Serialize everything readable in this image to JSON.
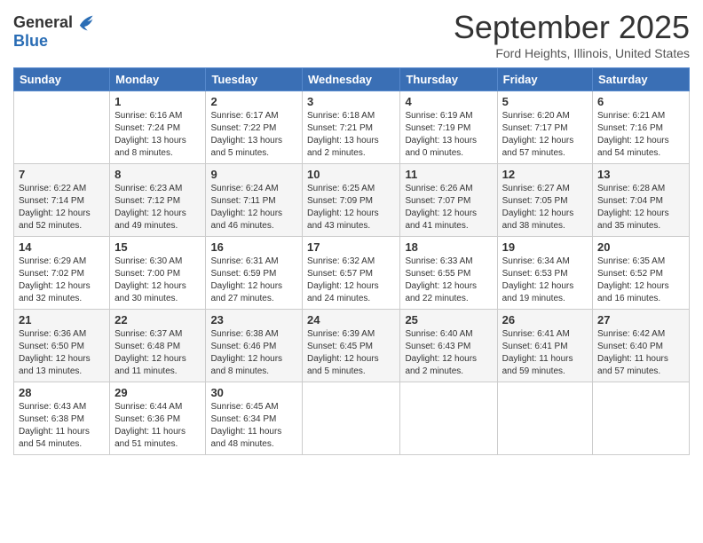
{
  "header": {
    "logo_general": "General",
    "logo_blue": "Blue",
    "month_title": "September 2025",
    "subtitle": "Ford Heights, Illinois, United States"
  },
  "days_of_week": [
    "Sunday",
    "Monday",
    "Tuesday",
    "Wednesday",
    "Thursday",
    "Friday",
    "Saturday"
  ],
  "weeks": [
    [
      null,
      {
        "day": "1",
        "sunrise": "6:16 AM",
        "sunset": "7:24 PM",
        "daylight": "13 hours and 8 minutes."
      },
      {
        "day": "2",
        "sunrise": "6:17 AM",
        "sunset": "7:22 PM",
        "daylight": "13 hours and 5 minutes."
      },
      {
        "day": "3",
        "sunrise": "6:18 AM",
        "sunset": "7:21 PM",
        "daylight": "13 hours and 2 minutes."
      },
      {
        "day": "4",
        "sunrise": "6:19 AM",
        "sunset": "7:19 PM",
        "daylight": "13 hours and 0 minutes."
      },
      {
        "day": "5",
        "sunrise": "6:20 AM",
        "sunset": "7:17 PM",
        "daylight": "12 hours and 57 minutes."
      },
      {
        "day": "6",
        "sunrise": "6:21 AM",
        "sunset": "7:16 PM",
        "daylight": "12 hours and 54 minutes."
      }
    ],
    [
      {
        "day": "7",
        "sunrise": "6:22 AM",
        "sunset": "7:14 PM",
        "daylight": "12 hours and 52 minutes."
      },
      {
        "day": "8",
        "sunrise": "6:23 AM",
        "sunset": "7:12 PM",
        "daylight": "12 hours and 49 minutes."
      },
      {
        "day": "9",
        "sunrise": "6:24 AM",
        "sunset": "7:11 PM",
        "daylight": "12 hours and 46 minutes."
      },
      {
        "day": "10",
        "sunrise": "6:25 AM",
        "sunset": "7:09 PM",
        "daylight": "12 hours and 43 minutes."
      },
      {
        "day": "11",
        "sunrise": "6:26 AM",
        "sunset": "7:07 PM",
        "daylight": "12 hours and 41 minutes."
      },
      {
        "day": "12",
        "sunrise": "6:27 AM",
        "sunset": "7:05 PM",
        "daylight": "12 hours and 38 minutes."
      },
      {
        "day": "13",
        "sunrise": "6:28 AM",
        "sunset": "7:04 PM",
        "daylight": "12 hours and 35 minutes."
      }
    ],
    [
      {
        "day": "14",
        "sunrise": "6:29 AM",
        "sunset": "7:02 PM",
        "daylight": "12 hours and 32 minutes."
      },
      {
        "day": "15",
        "sunrise": "6:30 AM",
        "sunset": "7:00 PM",
        "daylight": "12 hours and 30 minutes."
      },
      {
        "day": "16",
        "sunrise": "6:31 AM",
        "sunset": "6:59 PM",
        "daylight": "12 hours and 27 minutes."
      },
      {
        "day": "17",
        "sunrise": "6:32 AM",
        "sunset": "6:57 PM",
        "daylight": "12 hours and 24 minutes."
      },
      {
        "day": "18",
        "sunrise": "6:33 AM",
        "sunset": "6:55 PM",
        "daylight": "12 hours and 22 minutes."
      },
      {
        "day": "19",
        "sunrise": "6:34 AM",
        "sunset": "6:53 PM",
        "daylight": "12 hours and 19 minutes."
      },
      {
        "day": "20",
        "sunrise": "6:35 AM",
        "sunset": "6:52 PM",
        "daylight": "12 hours and 16 minutes."
      }
    ],
    [
      {
        "day": "21",
        "sunrise": "6:36 AM",
        "sunset": "6:50 PM",
        "daylight": "12 hours and 13 minutes."
      },
      {
        "day": "22",
        "sunrise": "6:37 AM",
        "sunset": "6:48 PM",
        "daylight": "12 hours and 11 minutes."
      },
      {
        "day": "23",
        "sunrise": "6:38 AM",
        "sunset": "6:46 PM",
        "daylight": "12 hours and 8 minutes."
      },
      {
        "day": "24",
        "sunrise": "6:39 AM",
        "sunset": "6:45 PM",
        "daylight": "12 hours and 5 minutes."
      },
      {
        "day": "25",
        "sunrise": "6:40 AM",
        "sunset": "6:43 PM",
        "daylight": "12 hours and 2 minutes."
      },
      {
        "day": "26",
        "sunrise": "6:41 AM",
        "sunset": "6:41 PM",
        "daylight": "11 hours and 59 minutes."
      },
      {
        "day": "27",
        "sunrise": "6:42 AM",
        "sunset": "6:40 PM",
        "daylight": "11 hours and 57 minutes."
      }
    ],
    [
      {
        "day": "28",
        "sunrise": "6:43 AM",
        "sunset": "6:38 PM",
        "daylight": "11 hours and 54 minutes."
      },
      {
        "day": "29",
        "sunrise": "6:44 AM",
        "sunset": "6:36 PM",
        "daylight": "11 hours and 51 minutes."
      },
      {
        "day": "30",
        "sunrise": "6:45 AM",
        "sunset": "6:34 PM",
        "daylight": "11 hours and 48 minutes."
      },
      null,
      null,
      null,
      null
    ]
  ]
}
